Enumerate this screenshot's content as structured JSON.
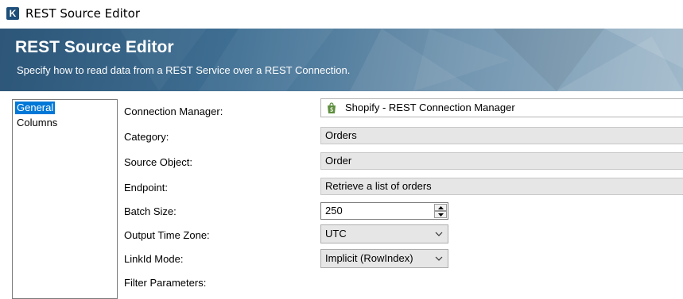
{
  "window": {
    "title": "REST Source Editor"
  },
  "banner": {
    "title": "REST Source Editor",
    "subtitle": "Specify how to read data from a REST Service over a REST Connection."
  },
  "nav": {
    "items": [
      {
        "label": "General",
        "selected": true
      },
      {
        "label": "Columns",
        "selected": false
      }
    ]
  },
  "form": {
    "connection_manager": {
      "label": "Connection Manager:",
      "value": "Shopify - REST Connection Manager",
      "icon": "shopify-bag-icon"
    },
    "category": {
      "label": "Category:",
      "value": "Orders"
    },
    "source_object": {
      "label": "Source Object:",
      "value": "Order"
    },
    "endpoint": {
      "label": "Endpoint:",
      "value": "Retrieve a list of orders"
    },
    "batch_size": {
      "label": "Batch Size:",
      "value": "250"
    },
    "output_time_zone": {
      "label": "Output Time Zone:",
      "value": "UTC"
    },
    "linkid_mode": {
      "label": "LinkId Mode:",
      "value": "Implicit (RowIndex)"
    },
    "filter_parameters": {
      "label": "Filter Parameters:"
    }
  },
  "colors": {
    "accent": "#0078d7",
    "banner_dark": "#2d5678",
    "shopify_green": "#5e8e3e"
  }
}
